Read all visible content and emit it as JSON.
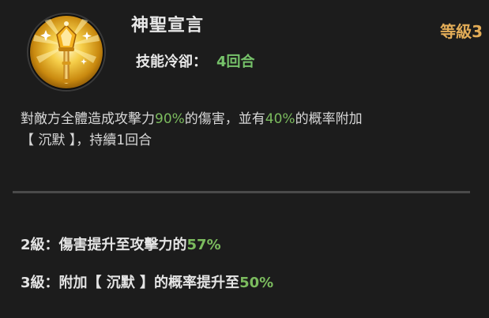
{
  "skill": {
    "name": "神聖宣言",
    "icon": "golden-scepter-icon",
    "level_label": "等級3",
    "cooldown_label": "技能冷卻：",
    "cooldown_value": "4回合"
  },
  "description": {
    "part1": "對敵方全體造成攻擊力",
    "atk_percent": "90%",
    "part2": "的傷害，並有",
    "chance_percent": "40%",
    "part3": "的概率附加",
    "part4": "【 沉默 】，持續1回合"
  },
  "upgrades": [
    {
      "prefix": "2級：傷害提升至攻擊力的",
      "value": "57%",
      "suffix": ""
    },
    {
      "prefix": "3級：附加【 沉默 】的概率提升至",
      "value": "50%",
      "suffix": ""
    }
  ],
  "colors": {
    "background": "#1c1c1c",
    "highlight_green": "#7bbb5e",
    "level_gold": "#e2ac57",
    "text": "#e8e8e8"
  }
}
